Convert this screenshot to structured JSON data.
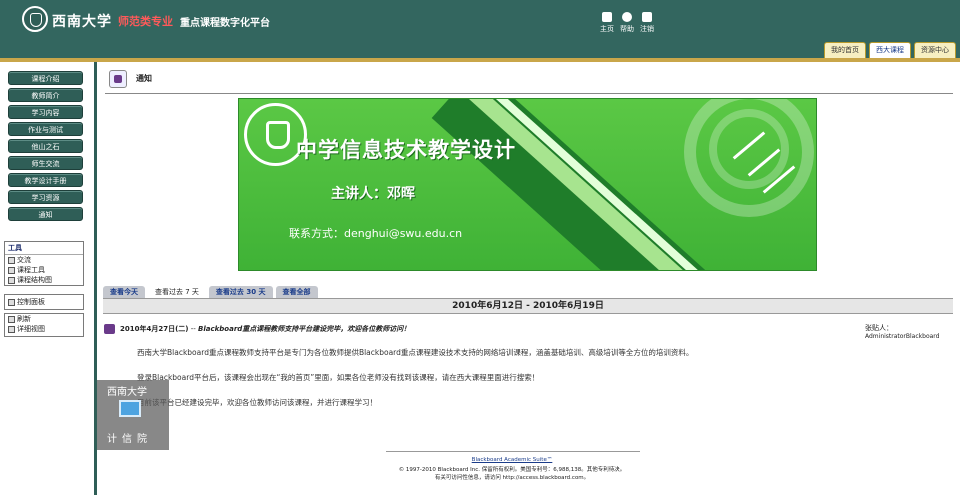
{
  "header": {
    "school_name": "西南大学",
    "title_red": "师范类专业",
    "title_white": "重点课程数字化平台",
    "nav": [
      {
        "label": "主页",
        "icon": "home-icon"
      },
      {
        "label": "帮助",
        "icon": "help-icon"
      },
      {
        "label": "注销",
        "icon": "logout-icon"
      }
    ],
    "tabs": [
      {
        "label": "我的首页",
        "active": false
      },
      {
        "label": "西大课程",
        "active": true
      },
      {
        "label": "资源中心",
        "active": false
      }
    ]
  },
  "sidebar": {
    "menu": [
      "课程介绍",
      "教师简介",
      "学习内容",
      "作业与测试",
      "他山之石",
      "师生交流",
      "教学设计手册",
      "学习资源",
      "通知"
    ],
    "tools_title": "工具",
    "tools": [
      {
        "label": "交流",
        "icon": "chat-icon"
      },
      {
        "label": "课程工具",
        "icon": "tools-icon"
      },
      {
        "label": "课程结构图",
        "icon": "map-icon"
      }
    ],
    "control_panel": "控制面板",
    "refresh": "刷新",
    "detail_view": "详细视图"
  },
  "main": {
    "page_title": "通知",
    "banner": {
      "title": "中学信息技术教学设计",
      "host": "主讲人：邓晖",
      "contact": "联系方式：denghui@swu.edu.cn"
    },
    "date_tabs": [
      {
        "label": "查看今天",
        "active": false
      },
      {
        "label": "查看过去 7 天",
        "active": true
      },
      {
        "label": "查看过去 30 天",
        "active": false
      },
      {
        "label": "查看全部",
        "active": false
      }
    ],
    "range": "2010年6月12日  - 2010年6月19日",
    "announcement": {
      "date": "2010年4月27日(二)",
      "separator": " -- ",
      "subject": "Blackboard重点课程教师支持平台建设完毕，欢迎各位教师访问！",
      "poster_label": "张贴人：",
      "poster_name": "AdministratorBlackboard",
      "paragraphs": [
        "西南大学Blackboard重点课程教师支持平台是专门为各位教师提供Blackboard重点课程建设技术支持的网络培训课程，涵盖基础培训、高级培训等全方位的培训资料。",
        "登录Blackboard平台后，该课程会出现在“我的首页”里面，如果各位老师没有找到该课程，请在西大课程里面进行搜索！",
        "目前该平台已经建设完毕，欢迎各位教师访问该课程，并进行课程学习！"
      ]
    },
    "footer": {
      "suite_link": "Blackboard Academic Suite™",
      "copyright": "© 1997-2010 Blackboard Inc. 保留所有权利。美国专利号：6,988,138。其他专利待决。",
      "access": "有关可访问性信息，请访问 http://access.blackboard.com。"
    }
  },
  "watermark": {
    "top": "西南大学",
    "bottom": "计信院"
  }
}
